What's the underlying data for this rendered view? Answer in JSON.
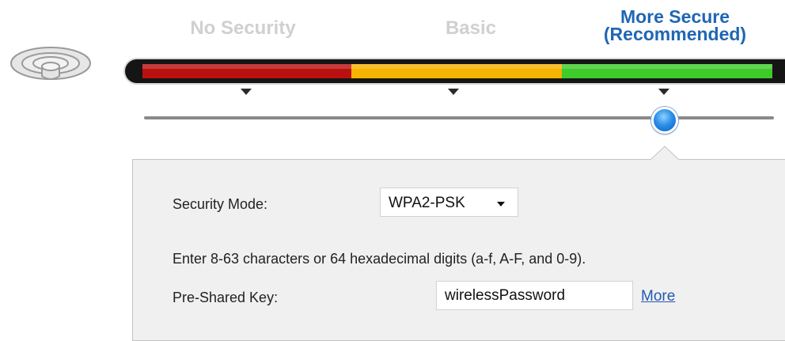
{
  "security_levels": [
    {
      "label": "No Security",
      "active": false
    },
    {
      "label": "Basic",
      "active": false
    },
    {
      "label": "More Secure\n(Recommended)",
      "active": true
    }
  ],
  "colors": {
    "inactive_label": "#d0d0d0",
    "active_label": "#1f66b5",
    "level_red": "#bb1010",
    "level_orange": "#f6b300",
    "level_green": "#3fcb2a",
    "link": "#2458b4"
  },
  "slider": {
    "selected_level_index": 2,
    "levels_count": 3
  },
  "panel": {
    "security_mode": {
      "label": "Security Mode:",
      "value": "WPA2-PSK"
    },
    "hint": "Enter 8-63 characters or 64 hexadecimal digits (a-f, A-F, and 0-9).",
    "psk": {
      "label": "Pre-Shared Key:",
      "value": "wirelessPassword"
    },
    "more_link": "More"
  },
  "icons": {
    "wireless": "wifi-router-icon",
    "dropdown": "chevron-down-icon"
  }
}
